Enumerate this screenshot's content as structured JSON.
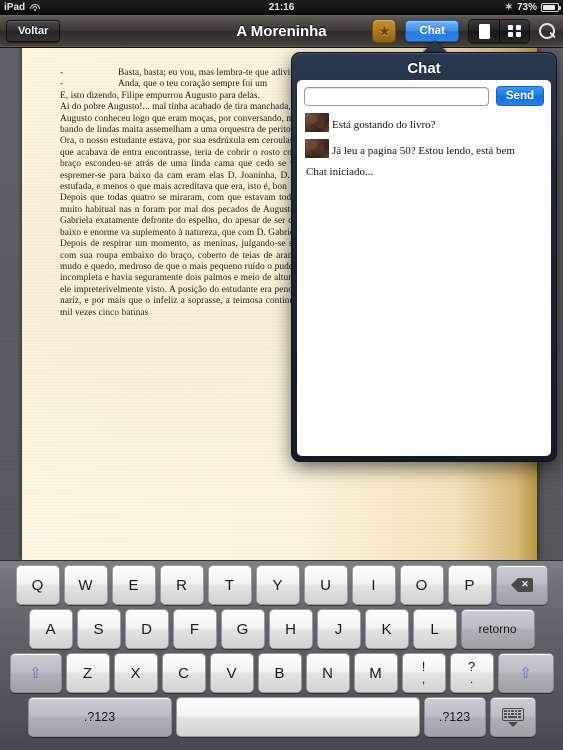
{
  "statusbar": {
    "device": "iPad",
    "wifi_icon": "wifi-icon",
    "time": "21:16",
    "bluetooth_icon": "bluetooth-icon",
    "battery_percent": "73%",
    "battery_icon": "battery-icon"
  },
  "toolbar": {
    "back_label": "Voltar",
    "title": "A Moreninha",
    "bookmark_icon": "star-bookmark-icon",
    "bookmark_glyph": "★",
    "chat_label": "Chat",
    "segment_page_icon": "single-page-icon",
    "segment_grid_icon": "grid-view-icon",
    "search_icon": "search-icon",
    "chat_button_color": "#2a7ade",
    "bookmark_color": "#a9781e"
  },
  "reader": {
    "paragraphs": [
      {
        "type": "dialog",
        "dash": "-",
        "text": "Basta, basta; eu vou, mas lembra-te que adivinha..."
      },
      {
        "type": "dialog",
        "dash": "-",
        "text": "Anda, que o teu coração sempre foi um"
      },
      {
        "type": "plain",
        "text": "E, isto dizendo, Filipe empurrou Augusto para delas."
      },
      {
        "type": "plain",
        "text": "Ai do pobre Augusto!... mal tinha acabado de tira manchada, sentiu rumor que faziam algumas pes"
      },
      {
        "type": "plain",
        "text": "Augusto conheceu logo que eram moças, por conversando, matinada tal, que a um quarto de lé insólito compará-las a um bando de lindas maita assemelham a uma orquestra de peritos instrume"
      },
      {
        "type": "plain",
        "text": "Ora, o nosso estudante estava, por sua esdrúxula em ceroulas e nu da cintura para cima, faria recu mais, ao belo povinho que acabava de entra encontrasse, teria de cobrir o rosto com as mãos pensamento que lhe veio à mente: ajuntou toda braço escondeu-se atrás de uma linda cama que cedo se veria livre de tão intempestiva visita; ma de agachar-se e espremer-se para baixo da cam eram elas D. Joaninha, D. Quinquina, D. Clem adocicada, muito espartilhada, muito estufada, e menos o que mais acreditava que era, isto é, bon"
      },
      {
        "type": "indent",
        "text": "Depois que todas quatro se miraram, com que estavam todos muito em ordem, mas que a puderam resistir ao prazer, muito habitual nas n foram por mal dos pecados de Augusto, sentar Joaninha na cama, embaixo da qual estava ele; D. Gabriela exatamente defronte do espelho, do apesar de ser de braços e larga, pequena era par saias, saiotes, vestidos de baixo e enorme va suplemento à natureza, que com D. Gabriela, seg pouco mesquinha a certos respeitos."
      },
      {
        "type": "plain",
        "text": "Depois de respirar um momento, as meninas, julgando-se sós, começaram a conversar livremente, enquanto Augusto, com sua roupa embaixo do braço, coberto de teias de aranha e suores frios, comprimia a respiração e conservava-se mudo e quedo, medroso de que o mais pequeno ruído o pudesse descobrir; para meu mor infortúnio, a barra da cama era incompleta e havia seguramente dois palmos e meio de altura descobertos, por onde, se alguma das moças olhasse, seria ele impreterivelmente visto. A posição do estudante era penosa, certamente; por último, saltou-lhe uma pulga à ponta do nariz, e por mais que o infeliz a soprasse, a teimosa continuou a chuchá-lo com a mais descarada impunidade.  - Antes mil vezes cinco batinas"
      }
    ]
  },
  "chat": {
    "title": "Chat",
    "input_value": "",
    "input_placeholder": "",
    "send_label": "Send",
    "messages": [
      {
        "avatar": "user-avatar",
        "text": "Está gostando do livro?"
      },
      {
        "avatar": "user-avatar",
        "text": "Já leu a pagina 50? Estou lendo, está bem"
      }
    ],
    "system_message": "Chat iniciado..."
  },
  "keyboard": {
    "row1": [
      "Q",
      "W",
      "E",
      "R",
      "T",
      "Y",
      "U",
      "I",
      "O",
      "P"
    ],
    "backspace_icon": "backspace-icon",
    "row2": [
      "A",
      "S",
      "D",
      "F",
      "G",
      "H",
      "J",
      "K",
      "L"
    ],
    "return_label": "retorno",
    "shift_icon": "shift-icon",
    "row3": [
      "Z",
      "X",
      "C",
      "V",
      "B",
      "N",
      "M"
    ],
    "punct1_top": "!",
    "punct1_bot": ",",
    "punct2_top": "?",
    "punct2_bot": ".",
    "numeric_left_label": ".?123",
    "space_label": "",
    "numeric_right_label": ".?123",
    "hide_keyboard_icon": "hide-keyboard-icon"
  }
}
